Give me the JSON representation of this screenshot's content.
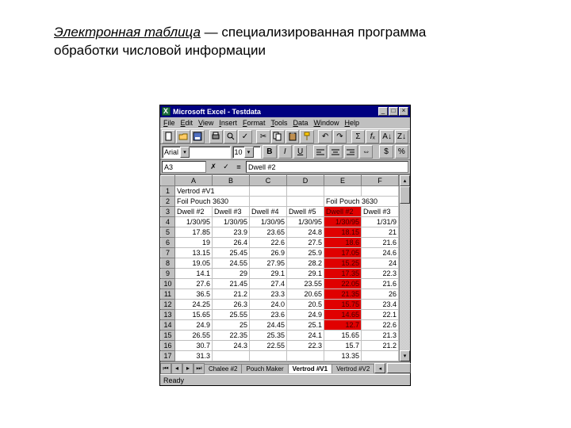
{
  "heading": {
    "term": "Электронная таблица",
    "rest1": " — специализированная программа",
    "rest2": "обработки числовой информации"
  },
  "app": {
    "title": "Microsoft Excel - Testdata",
    "menus": [
      "File",
      "Edit",
      "View",
      "Insert",
      "Format",
      "Tools",
      "Data",
      "Window",
      "Help"
    ],
    "font_name": "Arial",
    "font_size": "10",
    "name_box": "A3",
    "formula": "Dwell #2",
    "status": "Ready",
    "columns": [
      "A",
      "B",
      "C",
      "D",
      "E",
      "F"
    ],
    "sheets_left": [
      "Chalee #2",
      "Pouch Maker"
    ],
    "sheet_active": "Vertrod #V1",
    "sheets_right": [
      "Vertrod #V2"
    ],
    "rows": [
      {
        "n": "1",
        "cells": [
          {
            "v": "Vertrod #V1",
            "cls": "lft",
            "span": 2
          },
          {
            "v": ""
          },
          {
            "v": ""
          },
          {
            "v": ""
          },
          {
            "v": ""
          }
        ]
      },
      {
        "n": "2",
        "cells": [
          {
            "v": "Foil Pouch 3630",
            "cls": "lft",
            "span": 2
          },
          {
            "v": ""
          },
          {
            "v": ""
          },
          {
            "v": "Foil Pouch 3630",
            "cls": "lft",
            "span": 2
          }
        ]
      },
      {
        "n": "3",
        "cells": [
          {
            "v": "Dwell #2",
            "cls": "lft"
          },
          {
            "v": "Dwell #3",
            "cls": "lft"
          },
          {
            "v": "Dwell #4",
            "cls": "lft"
          },
          {
            "v": "Dwell #5",
            "cls": "lft"
          },
          {
            "v": "Dwell #2",
            "cls": "lft red"
          },
          {
            "v": "Dwell #3",
            "cls": "lft"
          }
        ]
      },
      {
        "n": "4",
        "cells": [
          {
            "v": "1/30/95"
          },
          {
            "v": "1/30/95"
          },
          {
            "v": "1/30/95"
          },
          {
            "v": "1/30/95"
          },
          {
            "v": "1/30/95",
            "cls": "red"
          },
          {
            "v": "1/31/9"
          }
        ]
      },
      {
        "n": "5",
        "cells": [
          {
            "v": "17.85"
          },
          {
            "v": "23.9"
          },
          {
            "v": "23.65"
          },
          {
            "v": "24.8"
          },
          {
            "v": "18.15",
            "cls": "red"
          },
          {
            "v": "21"
          }
        ]
      },
      {
        "n": "6",
        "cells": [
          {
            "v": "19"
          },
          {
            "v": "26.4"
          },
          {
            "v": "22.6"
          },
          {
            "v": "27.5"
          },
          {
            "v": "18.6",
            "cls": "red"
          },
          {
            "v": "21.6"
          }
        ]
      },
      {
        "n": "7",
        "cells": [
          {
            "v": "13.15"
          },
          {
            "v": "25.45"
          },
          {
            "v": "26.9"
          },
          {
            "v": "25.9"
          },
          {
            "v": "17.05",
            "cls": "red"
          },
          {
            "v": "24.6"
          }
        ]
      },
      {
        "n": "8",
        "cells": [
          {
            "v": "19.05"
          },
          {
            "v": "24.55"
          },
          {
            "v": "27.95"
          },
          {
            "v": "28.2"
          },
          {
            "v": "15.25",
            "cls": "red"
          },
          {
            "v": "24"
          }
        ]
      },
      {
        "n": "9",
        "cells": [
          {
            "v": "14.1"
          },
          {
            "v": "29"
          },
          {
            "v": "29.1"
          },
          {
            "v": "29.1"
          },
          {
            "v": "17.35",
            "cls": "red"
          },
          {
            "v": "22.3"
          }
        ]
      },
      {
        "n": "10",
        "cells": [
          {
            "v": "27.6"
          },
          {
            "v": "21.45"
          },
          {
            "v": "27.4"
          },
          {
            "v": "23.55"
          },
          {
            "v": "22.05",
            "cls": "red"
          },
          {
            "v": "21.6"
          }
        ]
      },
      {
        "n": "11",
        "cells": [
          {
            "v": "36.5"
          },
          {
            "v": "21.2"
          },
          {
            "v": "23.3"
          },
          {
            "v": "20.65"
          },
          {
            "v": "21.35",
            "cls": "red"
          },
          {
            "v": "26"
          }
        ]
      },
      {
        "n": "12",
        "cells": [
          {
            "v": "24.25"
          },
          {
            "v": "26.3"
          },
          {
            "v": "24.0"
          },
          {
            "v": "20.5"
          },
          {
            "v": "15.75",
            "cls": "red"
          },
          {
            "v": "23.4"
          }
        ]
      },
      {
        "n": "13",
        "cells": [
          {
            "v": "15.65"
          },
          {
            "v": "25.55"
          },
          {
            "v": "23.6"
          },
          {
            "v": "24.9"
          },
          {
            "v": "14.65",
            "cls": "red"
          },
          {
            "v": "22.1"
          }
        ]
      },
      {
        "n": "14",
        "cells": [
          {
            "v": "24.9"
          },
          {
            "v": "25"
          },
          {
            "v": "24.45"
          },
          {
            "v": "25.1"
          },
          {
            "v": "12.7",
            "cls": "red"
          },
          {
            "v": "22.6"
          }
        ]
      },
      {
        "n": "15",
        "cells": [
          {
            "v": "26.55"
          },
          {
            "v": "22.35"
          },
          {
            "v": "25.35"
          },
          {
            "v": "24.1"
          },
          {
            "v": "15.65"
          },
          {
            "v": "21.3"
          }
        ]
      },
      {
        "n": "16",
        "cells": [
          {
            "v": "30.7"
          },
          {
            "v": "24.3"
          },
          {
            "v": "22.55"
          },
          {
            "v": "22.3"
          },
          {
            "v": "15.7"
          },
          {
            "v": "21.2"
          }
        ]
      },
      {
        "n": "17",
        "cells": [
          {
            "v": "31.3"
          },
          {
            "v": ""
          },
          {
            "v": ""
          },
          {
            "v": ""
          },
          {
            "v": "13.35"
          },
          {
            "v": ""
          }
        ]
      }
    ],
    "icons": {
      "min": "_",
      "max": "□",
      "close": "×",
      "bold": "B",
      "italic": "I",
      "underline": "U"
    }
  }
}
